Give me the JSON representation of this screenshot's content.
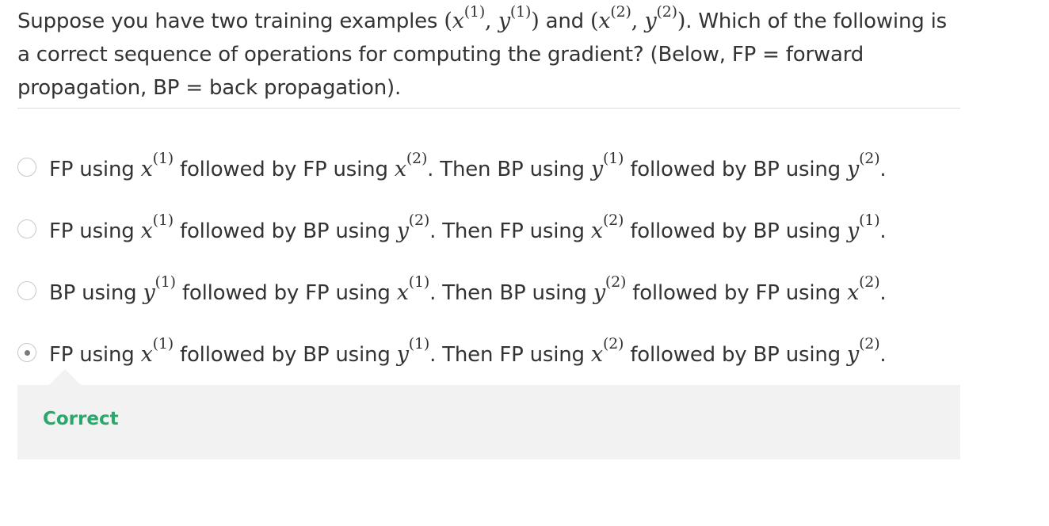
{
  "question": {
    "part1": "Suppose you have two training examples ",
    "ex1_x": "x",
    "ex1_x_sup": "(1)",
    "comma": ", ",
    "ex1_y": "y",
    "ex1_y_sup": "(1)",
    "and": " and ",
    "ex2_x": "x",
    "ex2_x_sup": "(2)",
    "ex2_y": "y",
    "ex2_y_sup": "(2)",
    "part2": ". Which of the following is a correct sequence of operations for computing the gradient? (Below, FP = forward propagation, BP = back propagation)."
  },
  "options": [
    {
      "a": "FP using ",
      "v1": "x",
      "s1": "(1)",
      "b": " followed by FP using ",
      "v2": "x",
      "s2": "(2)",
      "c": ". Then BP using ",
      "v3": "y",
      "s3": "(1)",
      "d": " followed by BP using ",
      "v4": "y",
      "s4": "(2)",
      "e": ".",
      "selected": false
    },
    {
      "a": "FP using ",
      "v1": "x",
      "s1": "(1)",
      "b": " followed by BP using ",
      "v2": "y",
      "s2": "(2)",
      "c": ". Then FP using ",
      "v3": "x",
      "s3": "(2)",
      "d": " followed by BP using ",
      "v4": "y",
      "s4": "(1)",
      "e": ".",
      "selected": false
    },
    {
      "a": "BP using ",
      "v1": "y",
      "s1": "(1)",
      "b": " followed by FP using ",
      "v2": "x",
      "s2": "(1)",
      "c": ". Then BP using ",
      "v3": "y",
      "s3": "(2)",
      "d": " followed by FP using ",
      "v4": "x",
      "s4": "(2)",
      "e": ".",
      "selected": false
    },
    {
      "a": "FP using ",
      "v1": "x",
      "s1": "(1)",
      "b": " followed by BP using ",
      "v2": "y",
      "s2": "(1)",
      "c": ". Then FP using ",
      "v3": "x",
      "s3": "(2)",
      "d": " followed by BP using ",
      "v4": "y",
      "s4": "(2)",
      "e": ".",
      "selected": true
    }
  ],
  "feedback": {
    "label": "Correct",
    "color": "#2aa86b"
  }
}
